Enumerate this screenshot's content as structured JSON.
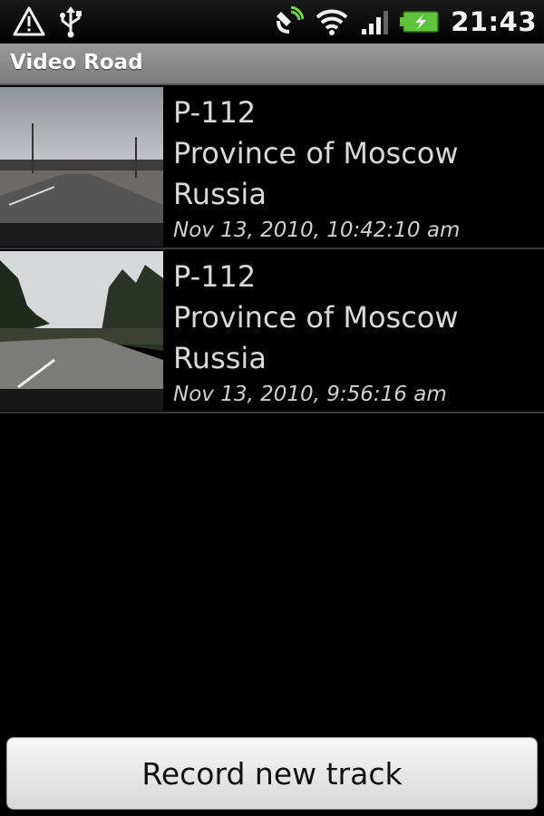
{
  "status_bar": {
    "time": "21:43",
    "icons": [
      "alert-icon",
      "usb-icon",
      "gps-icon",
      "wifi-icon",
      "signal-icon",
      "battery-charging-icon"
    ]
  },
  "app": {
    "title": "Video Road"
  },
  "tracks": [
    {
      "road": "P-112",
      "region": "Province of Moscow",
      "country": "Russia",
      "timestamp": "Nov 13, 2010, 10:42:10 am"
    },
    {
      "road": "P-112",
      "region": "Province of Moscow",
      "country": "Russia",
      "timestamp": "Nov 13, 2010, 9:56:16 am"
    }
  ],
  "actions": {
    "record_label": "Record new track"
  },
  "colors": {
    "background": "#000000",
    "titlebar": "#8a8a8a",
    "battery": "#5ec43b",
    "gps": "#6fd64a"
  }
}
